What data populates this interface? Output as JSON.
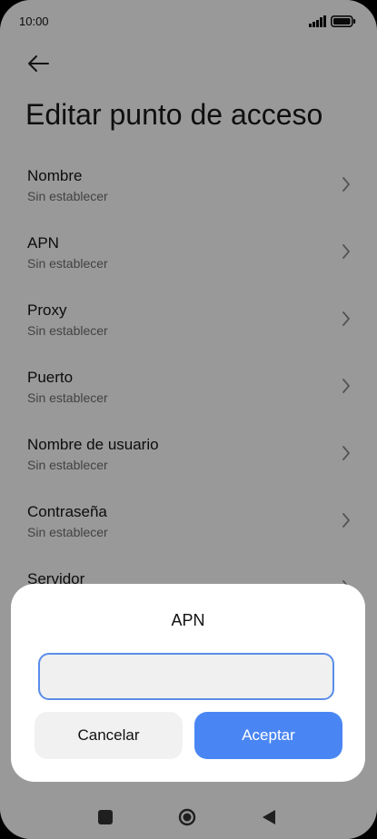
{
  "status_bar": {
    "time": "10:00"
  },
  "header": {
    "title": "Editar punto de acceso"
  },
  "settings": {
    "items": [
      {
        "title": "Nombre",
        "value": "Sin establecer"
      },
      {
        "title": "APN",
        "value": "Sin establecer"
      },
      {
        "title": "Proxy",
        "value": "Sin establecer"
      },
      {
        "title": "Puerto",
        "value": "Sin establecer"
      },
      {
        "title": "Nombre de usuario",
        "value": "Sin establecer"
      },
      {
        "title": "Contraseña",
        "value": "Sin establecer"
      },
      {
        "title": "Servidor",
        "value": ""
      }
    ]
  },
  "dialog": {
    "title": "APN",
    "input_value": "",
    "cancel_label": "Cancelar",
    "accept_label": "Aceptar"
  },
  "colors": {
    "accent": "#4a86f3",
    "input_border": "#5b8dea",
    "overlay": "#000000"
  },
  "icons": {
    "back": "arrow-left-icon",
    "chevron": "chevron-right-icon",
    "signal": "signal-icon",
    "battery": "battery-icon",
    "nav_recents": "square-icon",
    "nav_home": "circle-icon",
    "nav_back": "triangle-left-icon"
  }
}
